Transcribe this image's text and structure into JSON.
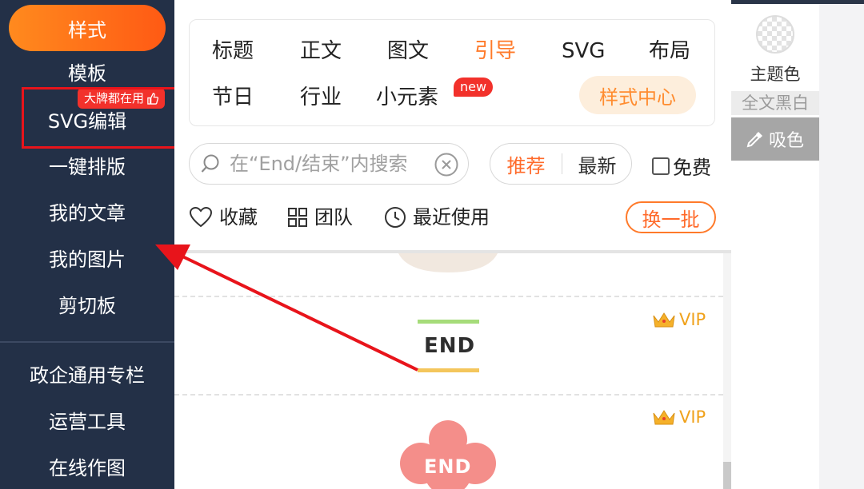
{
  "sidebar": {
    "active": "样式",
    "items": [
      "模板",
      "SVG编辑",
      "一键排版",
      "我的文章",
      "我的图片",
      "剪切板",
      "政企通用专栏",
      "运营工具",
      "在线作图"
    ],
    "hot_badge": "大牌都在用"
  },
  "categories": {
    "row1": [
      "标题",
      "正文",
      "图文",
      "引导",
      "SVG",
      "布局"
    ],
    "row2": [
      "节日",
      "行业",
      "小元素"
    ],
    "active": "引导",
    "new_badge": "new",
    "style_center": "样式中心"
  },
  "search": {
    "placeholder": "在“End/结束”内搜索"
  },
  "sort": {
    "recommended": "推荐",
    "latest": "最新"
  },
  "free_label": "免费",
  "tools": {
    "favorites": "收藏",
    "team": "团队",
    "recent": "最近使用",
    "refresh": "换一批"
  },
  "templates": [
    {
      "vip": "VIP",
      "text": "END"
    },
    {
      "vip": "VIP",
      "text": "END"
    }
  ],
  "right_panel": {
    "theme_color": "主题色",
    "black_white": "全文黑白",
    "picker": "吸色"
  },
  "colors": {
    "sidebar_bg": "#233047",
    "accent": "#ff7a2a",
    "annotation_red": "#e8141b"
  }
}
